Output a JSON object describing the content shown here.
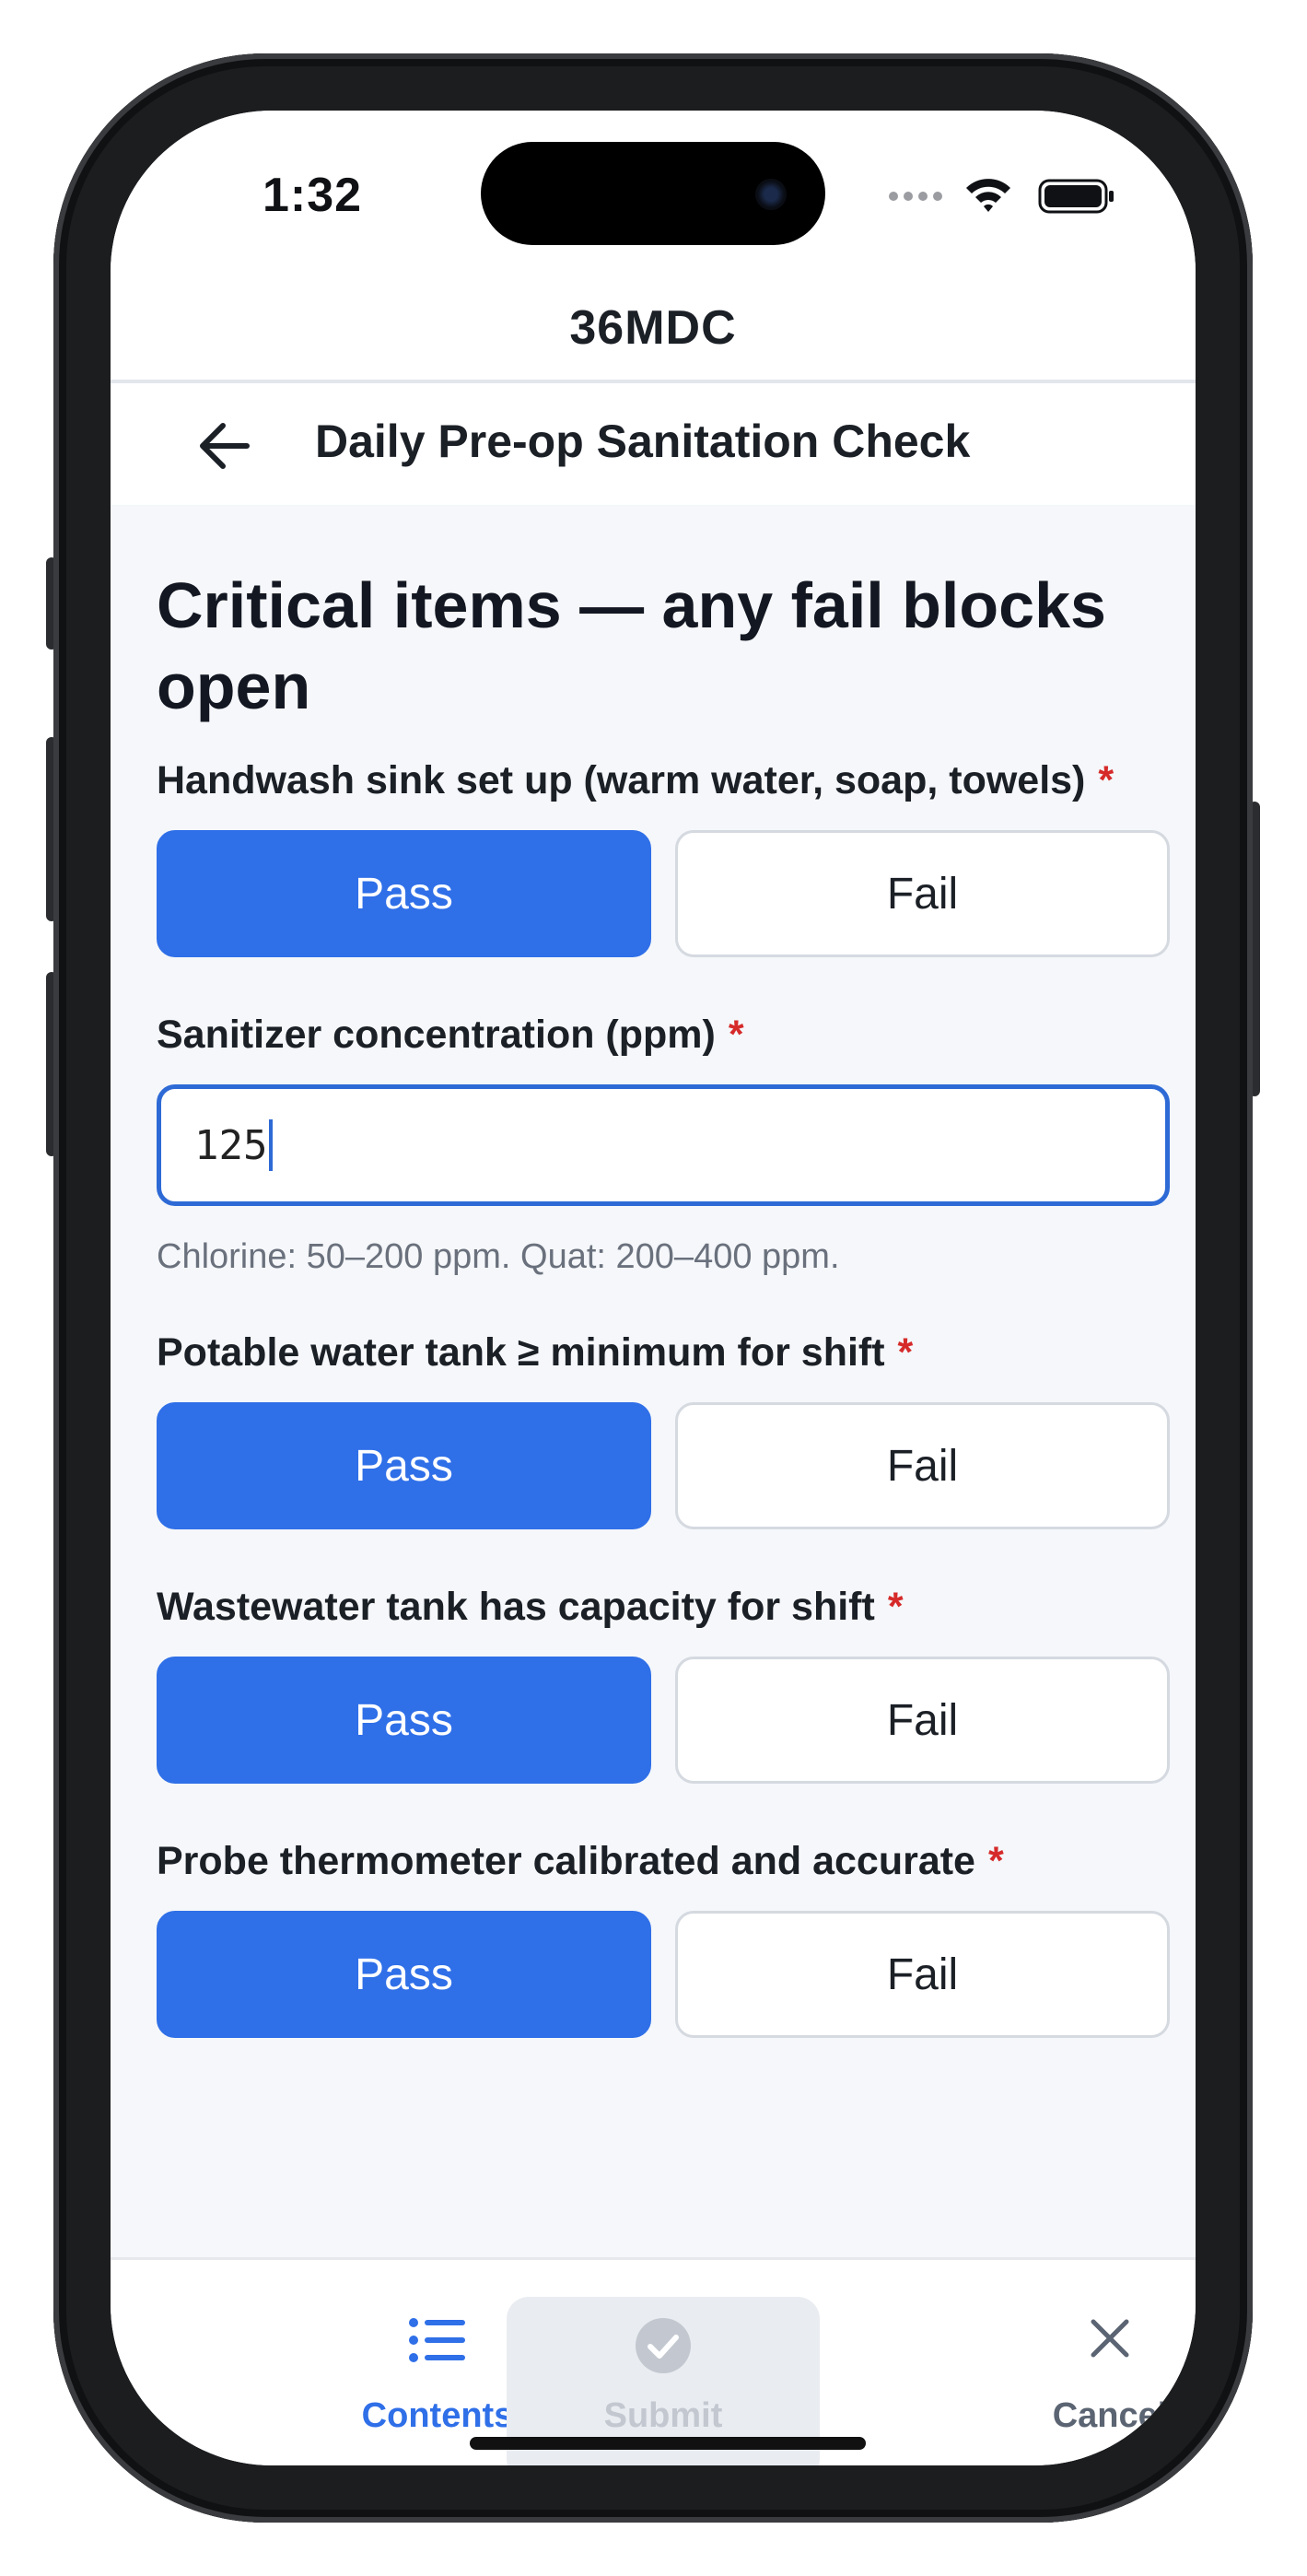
{
  "status_bar": {
    "time": "1:32"
  },
  "app_header": {
    "title": "36MDC"
  },
  "page_header": {
    "title": "Daily Pre-op Sanitation Check"
  },
  "section": {
    "title": "Critical items — any fail blocks open"
  },
  "fields": [
    {
      "label": "Handwash sink set up (warm water, soap, towels)",
      "required_mark": "*",
      "pass_label": "Pass",
      "fail_label": "Fail",
      "selected": "Pass"
    },
    {
      "label": "Sanitizer concentration (ppm)",
      "required_mark": "*",
      "value": "125",
      "help": "Chlorine: 50–200 ppm. Quat: 200–400 ppm."
    },
    {
      "label": "Potable water tank ≥ minimum for shift",
      "required_mark": "*",
      "pass_label": "Pass",
      "fail_label": "Fail",
      "selected": "Pass"
    },
    {
      "label": "Wastewater tank has capacity for shift",
      "required_mark": "*",
      "pass_label": "Pass",
      "fail_label": "Fail",
      "selected": "Pass"
    },
    {
      "label": "Probe thermometer calibrated and accurate",
      "required_mark": "*",
      "pass_label": "Pass",
      "fail_label": "Fail",
      "selected": "Pass"
    }
  ],
  "bottom_nav": {
    "contents_label": "Contents",
    "submit_label": "Submit",
    "cancel_label": "Cancel"
  },
  "colors": {
    "accent": "#2f6fe8",
    "required": "#d62a2a",
    "input_border": "#2e6ad6",
    "disabled": "#c3c8d0"
  },
  "icons": {
    "back": "arrow-left-icon",
    "contents": "list-icon",
    "submit": "check-circle-icon",
    "cancel": "close-icon"
  }
}
